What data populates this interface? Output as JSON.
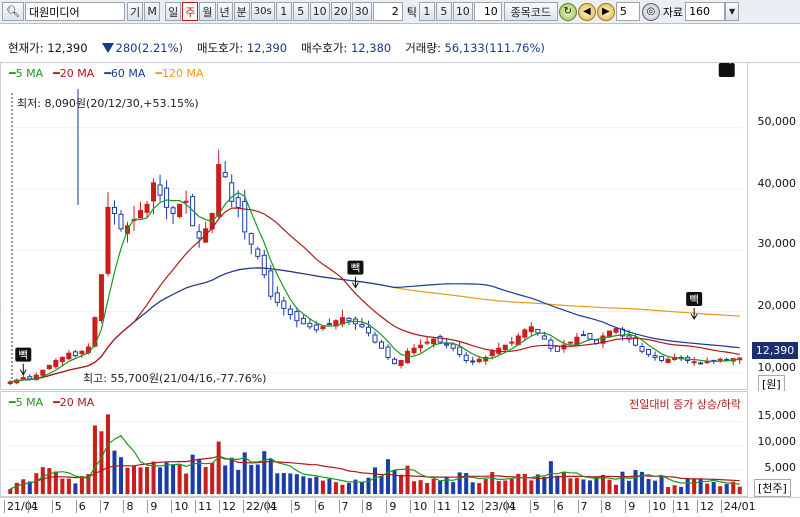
{
  "toolbar": {
    "search_icon": "search-icon",
    "search_mode": "🔍관",
    "stock_name": "대원미디어",
    "gi": "기",
    "m": "M",
    "periods": [
      "일",
      "주",
      "월",
      "년",
      "분"
    ],
    "active_period": "주",
    "seconds_label": "30s",
    "minute_buttons": [
      "1",
      "5",
      "10",
      "20",
      "30"
    ],
    "tick_value": "2",
    "tick_label": "틱",
    "tick_buttons": [
      "1",
      "5",
      "10"
    ],
    "tick_custom": "10",
    "code_label": "종목코드",
    "step_value": "5",
    "data_label": "자료",
    "data_count": "160"
  },
  "info": {
    "current_label": "현재가:",
    "current_value": "12,390",
    "change_value": "280(2.21%)",
    "ask_label": "매도호가:",
    "ask_value": "12,390",
    "bid_label": "매수호가:",
    "bid_value": "12,380",
    "volume_label": "거래량:",
    "volume_value": "56,133(111.76%)"
  },
  "price_legend": [
    {
      "label": "5 MA",
      "color": "#1a9a1a"
    },
    {
      "label": "20 MA",
      "color": "#b01818"
    },
    {
      "label": "60 MA",
      "color": "#1a3a9a"
    },
    {
      "label": "120 MA",
      "color": "#e89a1a"
    }
  ],
  "vol_legend": [
    {
      "label": "5 MA",
      "color": "#1a9a1a"
    },
    {
      "label": "20 MA",
      "color": "#b01818"
    }
  ],
  "price_notes": {
    "low": "최저: 8,090원(20/12/30,+53.15%)",
    "high": "최고: 55,700원(21/04/16,-77.76%)"
  },
  "vol_note": "전일대비 증가 상승/하락",
  "price_axis_labels": [
    "50,000",
    "40,000",
    "30,000",
    "20,000",
    "10,000"
  ],
  "price_unit": "[원]",
  "vol_axis_labels": [
    "15,000",
    "10,000",
    "5,000"
  ],
  "vol_unit": "[천주]",
  "current_badge": "12,390",
  "marker_text": "빽",
  "x_ticks": [
    "21/01",
    "4",
    "5",
    "6",
    "7",
    "8",
    "9",
    "10",
    "11",
    "12",
    "22/01",
    "4",
    "5",
    "6",
    "7",
    "8",
    "9",
    "10",
    "11",
    "12",
    "23/01",
    "4",
    "5",
    "6",
    "7",
    "8",
    "9",
    "10",
    "11",
    "12",
    "24/01"
  ],
  "colors": {
    "up": "#c81e1e",
    "down": "#1c3ca8",
    "ma5": "#1a9a1a",
    "ma20": "#b01818",
    "ma60": "#1a3a9a",
    "ma120": "#e89a1a"
  },
  "chart_data": {
    "type": "candlestick",
    "ylim": [
      8000,
      56000
    ],
    "weekly_close": [
      8500,
      8800,
      9200,
      9000,
      9600,
      10400,
      11200,
      12000,
      12500,
      13200,
      12800,
      13500,
      14200,
      19000,
      26000,
      37000,
      36000,
      33500,
      34000,
      35000,
      36500,
      37500,
      41000,
      39000,
      37000,
      36000,
      37500,
      38000,
      34000,
      32000,
      33500,
      36000,
      44000,
      42000,
      38000,
      37000,
      33000,
      31000,
      29000,
      26000,
      22500,
      21500,
      20500,
      19500,
      18500,
      18000,
      17500,
      17000,
      17500,
      18000,
      18500,
      19000,
      18500,
      18000,
      17500,
      16500,
      15000,
      14000,
      12500,
      11500,
      12000,
      13500,
      14000,
      14500,
      15000,
      15500,
      15000,
      14500,
      14000,
      13000,
      12000,
      11800,
      12200,
      12500,
      13500,
      14000,
      14500,
      15000,
      16000,
      17000,
      17500,
      16500,
      15500,
      14000,
      13500,
      14500,
      15000,
      15800,
      16200,
      15500,
      14800,
      16000,
      16800,
      17200,
      16000,
      15500,
      14500,
      13500,
      13000,
      12500,
      12000,
      12200,
      12500,
      12300,
      12000,
      11800,
      11600,
      11800,
      12000,
      12200,
      12100,
      12300,
      12390
    ],
    "ma120": "slow rising line peaking near 21,000 in 2023 then declining to ~16,500",
    "volume_axis": [
      0,
      17000
    ]
  }
}
